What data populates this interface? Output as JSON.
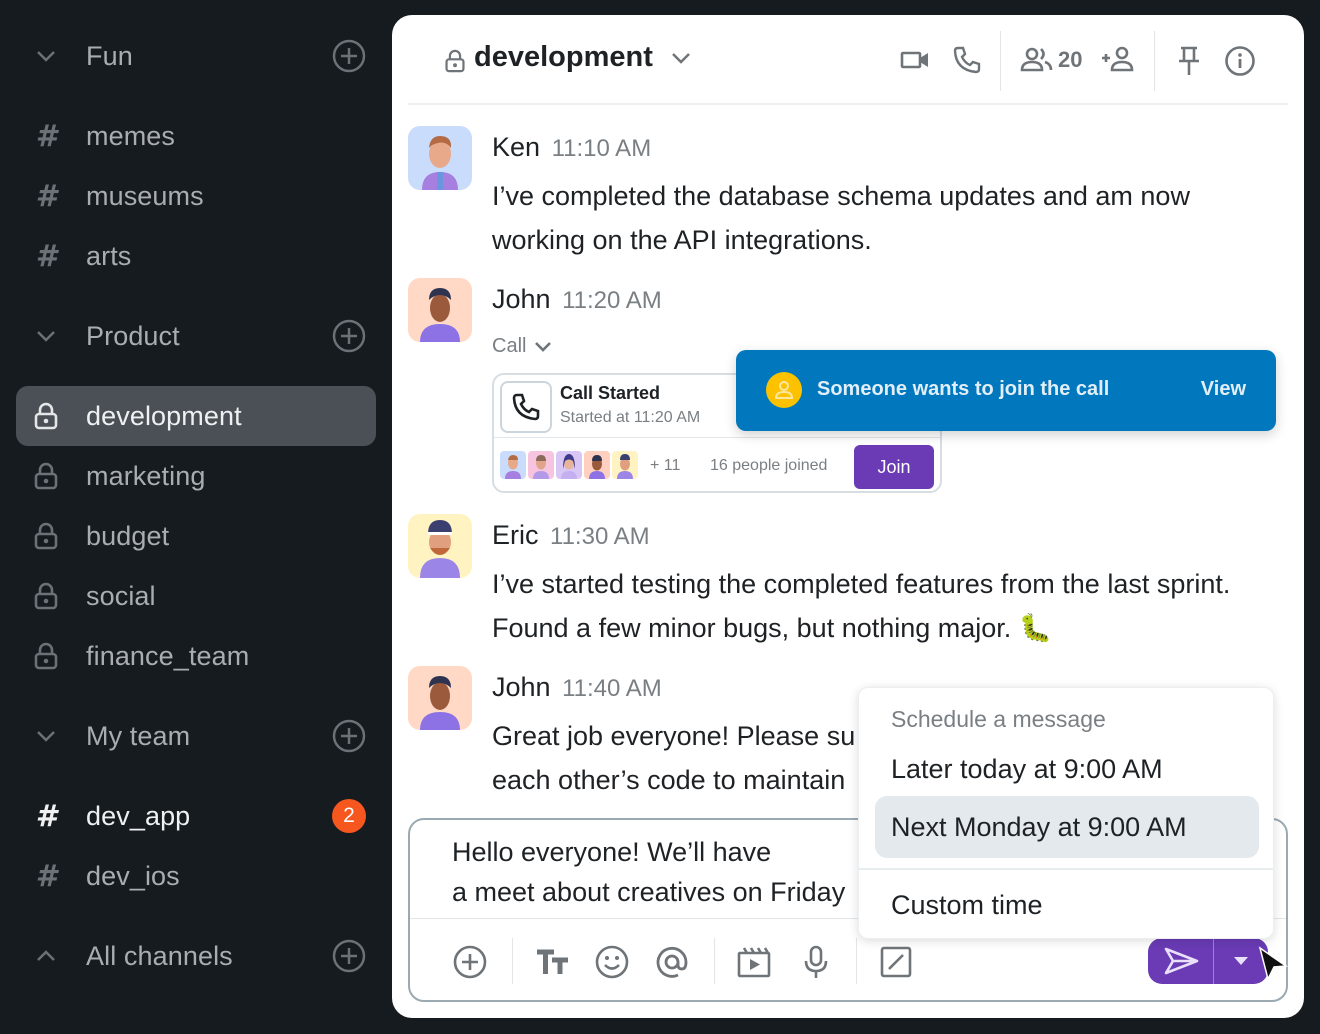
{
  "sidebar": {
    "sections": [
      {
        "title": "Fun",
        "collapsed": false,
        "channels": [
          {
            "name": "memes",
            "type": "public"
          },
          {
            "name": "museums",
            "type": "public"
          },
          {
            "name": "arts",
            "type": "public"
          }
        ]
      },
      {
        "title": "Product",
        "collapsed": false,
        "channels": [
          {
            "name": "development",
            "type": "private",
            "active": true
          },
          {
            "name": "marketing",
            "type": "private"
          },
          {
            "name": "budget",
            "type": "private"
          },
          {
            "name": "social",
            "type": "private"
          },
          {
            "name": "finance_team",
            "type": "private"
          }
        ]
      },
      {
        "title": "My team",
        "collapsed": false,
        "channels": [
          {
            "name": "dev_app",
            "type": "public",
            "unread": "2"
          },
          {
            "name": "dev_ios",
            "type": "public"
          }
        ]
      },
      {
        "title": "All channels",
        "collapsed": true,
        "channels": []
      }
    ]
  },
  "header": {
    "channel_name": "development",
    "member_count": "20",
    "icons": [
      "video-icon",
      "phone-icon",
      "members-icon",
      "add-member-icon",
      "pin-icon",
      "info-icon"
    ]
  },
  "messages": [
    {
      "author": "Ken",
      "time": "11:10 AM",
      "lines": [
        "I’ve completed the database schema updates and am now",
        "working on the API integrations."
      ]
    },
    {
      "author": "John",
      "time": "11:20 AM",
      "call": {
        "label": "Call",
        "title": "Call Started",
        "subtitle": "Started at 11:20 AM",
        "extra_count": "+ 11",
        "joined_text": "16 people joined",
        "join_label": "Join"
      }
    },
    {
      "author": "Eric",
      "time": "11:30 AM",
      "lines": [
        "I’ve started testing the completed features from the last sprint.",
        "Found a few minor bugs, but nothing major. 🐛"
      ]
    },
    {
      "author": "John",
      "time": "11:40 AM",
      "lines": [
        "Great job everyone! Please su",
        "each other’s code to maintain"
      ]
    }
  ],
  "toast": {
    "text": "Someone wants to join the call",
    "action": "View",
    "color": "#0177bd"
  },
  "composer": {
    "lines": [
      "Hello everyone! We’ll have",
      "a meet about creatives on Friday"
    ]
  },
  "schedule_menu": {
    "header": "Schedule a message",
    "options": [
      "Later today at 9:00 AM",
      "Next Monday at 9:00 AM",
      "Custom time"
    ],
    "selected_index": 1
  },
  "colors": {
    "accent": "#6a3bb5",
    "badge": "#f5571f",
    "sidebar_bg": "#151b1f"
  }
}
